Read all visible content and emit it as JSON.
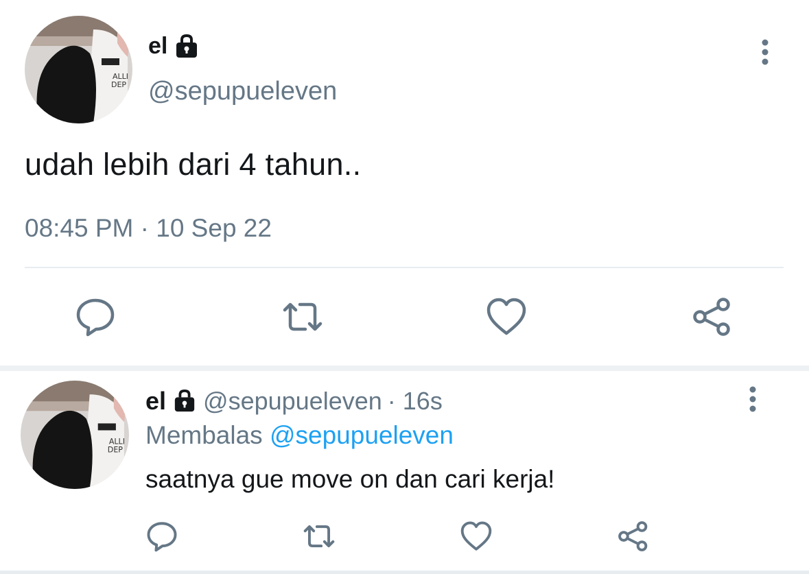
{
  "main_tweet": {
    "display_name": "el",
    "handle": "@sepupueleven",
    "text": "udah lebih dari 4 tahun..",
    "timestamp": "08:45 PM · 10 Sep 22",
    "icons": {
      "lock": "lock-icon",
      "more": "more-vertical-icon",
      "reply": "reply-icon",
      "retweet": "retweet-icon",
      "like": "heart-icon",
      "share": "share-icon"
    }
  },
  "reply_tweet": {
    "display_name": "el",
    "handle": "@sepupueleven",
    "time_ago": "· 16s",
    "replying_label": "Membalas",
    "replying_to": "@sepupueleven",
    "text": "saatnya gue move on dan cari kerja!"
  },
  "colors": {
    "text_primary": "#14171a",
    "text_secondary": "#657786",
    "link": "#1da1f2",
    "icon": "#657786",
    "divider": "#e6ecf0"
  }
}
